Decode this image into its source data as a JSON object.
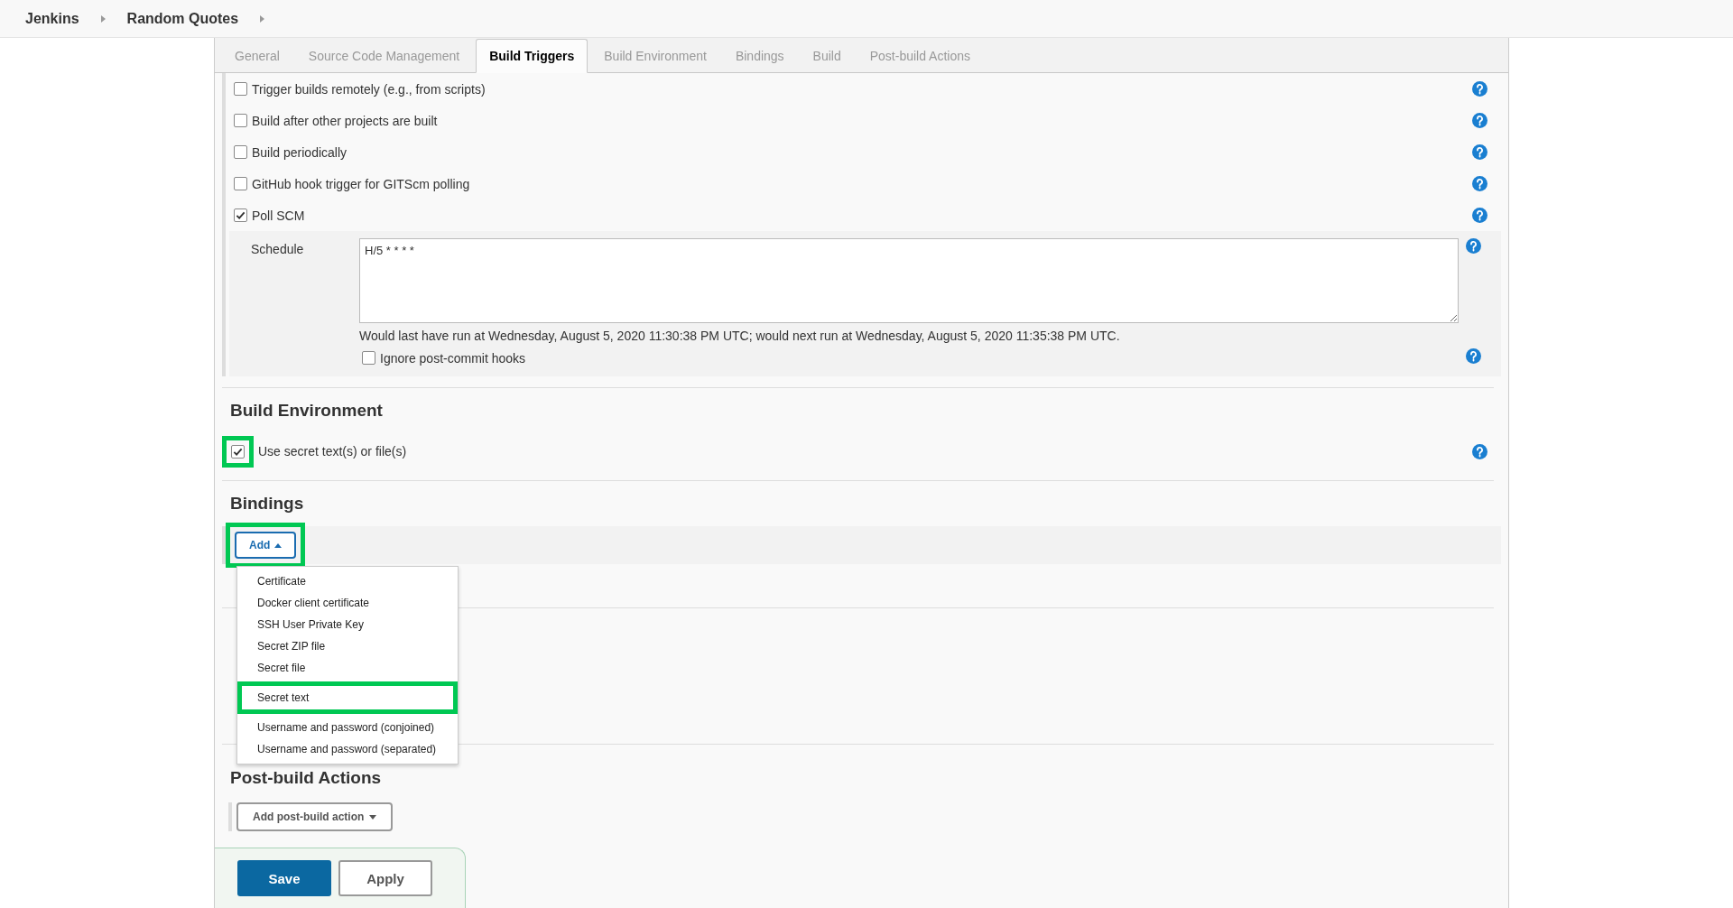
{
  "breadcrumbs": [
    {
      "label": "Jenkins"
    },
    {
      "label": "Random Quotes"
    }
  ],
  "tabs": [
    {
      "label": "General",
      "selected": false
    },
    {
      "label": "Source Code Management",
      "selected": false
    },
    {
      "label": "Build Triggers",
      "selected": true
    },
    {
      "label": "Build Environment",
      "selected": false
    },
    {
      "label": "Bindings",
      "selected": false
    },
    {
      "label": "Build",
      "selected": false
    },
    {
      "label": "Post-build Actions",
      "selected": false
    }
  ],
  "triggers": [
    {
      "label": "Trigger builds remotely (e.g., from scripts)",
      "checked": false
    },
    {
      "label": "Build after other projects are built",
      "checked": false
    },
    {
      "label": "Build periodically",
      "checked": false
    },
    {
      "label": "GitHub hook trigger for GITScm polling",
      "checked": false
    },
    {
      "label": "Poll SCM",
      "checked": true
    }
  ],
  "schedule": {
    "label": "Schedule",
    "value": "H/5 * * * *",
    "note": "Would last have run at Wednesday, August 5, 2020 11:30:38 PM UTC; would next run at Wednesday, August 5, 2020 11:35:38 PM UTC.",
    "ignore": {
      "label": "Ignore post-commit hooks",
      "checked": false
    }
  },
  "build_environment": {
    "heading": "Build Environment",
    "option": {
      "label": "Use secret text(s) or file(s)",
      "checked": true,
      "highlighted": true
    }
  },
  "bindings": {
    "heading": "Bindings",
    "add_button": {
      "label": "Add",
      "highlighted": true
    },
    "menu": [
      {
        "label": "Certificate",
        "highlighted": false
      },
      {
        "label": "Docker client certificate",
        "highlighted": false
      },
      {
        "label": "SSH User Private Key",
        "highlighted": false
      },
      {
        "label": "Secret ZIP file",
        "highlighted": false
      },
      {
        "label": "Secret file",
        "highlighted": false
      },
      {
        "label": "Secret text",
        "highlighted": true
      },
      {
        "label": "Username and password (conjoined)",
        "highlighted": false
      },
      {
        "label": "Username and password (separated)",
        "highlighted": false
      }
    ]
  },
  "post_build": {
    "heading": "Post-build Actions",
    "button": "Add post-build action"
  },
  "buttons": [
    {
      "label": "Save",
      "kind": "primary"
    },
    {
      "label": "Apply",
      "kind": "secondary"
    }
  ]
}
